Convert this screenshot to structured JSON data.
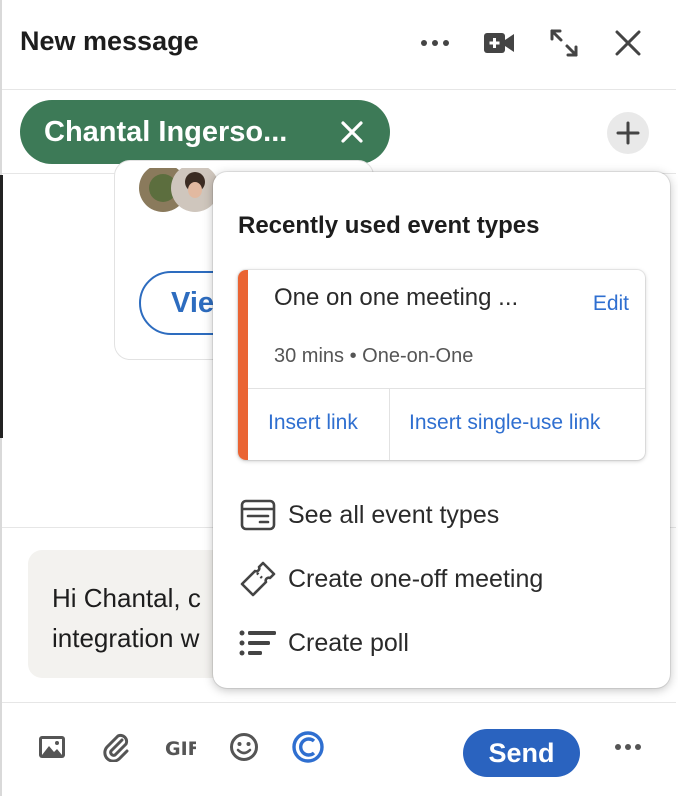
{
  "header": {
    "title": "New message",
    "more_icon": "ellipsis-icon",
    "video_icon": "video-camera-icon",
    "expand_icon": "expand-icon",
    "close_icon": "close-icon"
  },
  "recipients": {
    "chip_label": "Chantal Ingerso...",
    "chip_color": "#3d7a57",
    "add_icon": "plus-icon"
  },
  "thread": {
    "view_button_label": "Vie"
  },
  "compose": {
    "line1": "Hi Chantal, c",
    "line2": "integration w"
  },
  "footer": {
    "send_label": "Send",
    "send_color": "#2a63bf",
    "icons": [
      "image-icon",
      "attachment-icon",
      "gif-icon",
      "emoji-icon",
      "calendly-icon",
      "ellipsis-icon"
    ]
  },
  "popover": {
    "title": "Recently used event types",
    "event": {
      "name": "One on one meeting ...",
      "edit_label": "Edit",
      "meta": "30 mins • One-on-One",
      "accent_color": "#ea6433",
      "insert_link_label": "Insert link",
      "insert_single_label": "Insert single-use link"
    },
    "items": [
      {
        "label": "See all event types",
        "icon": "event-types-icon"
      },
      {
        "label": "Create one-off meeting",
        "icon": "ticket-icon"
      },
      {
        "label": "Create poll",
        "icon": "poll-icon"
      }
    ]
  }
}
